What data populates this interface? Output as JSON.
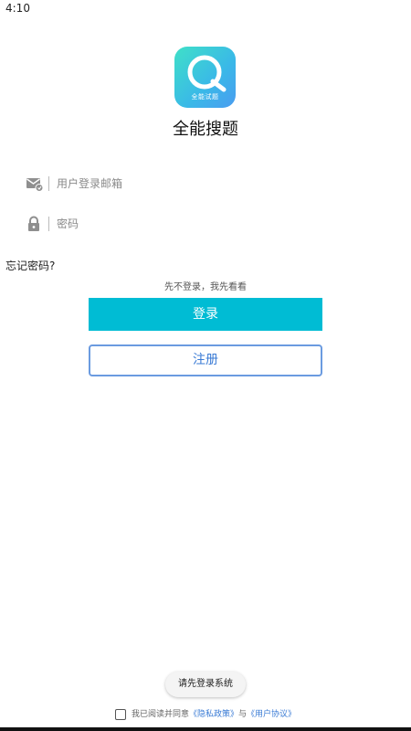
{
  "status_bar": {
    "time": "4:10"
  },
  "app": {
    "logo_text": "全能试题",
    "title": "全能搜题"
  },
  "login_form": {
    "email_placeholder": "用户登录邮箱",
    "password_placeholder": "密码",
    "forgot_password": "忘记密码?",
    "skip_login": "先不登录，我先看看",
    "login_button": "登录",
    "register_button": "注册"
  },
  "toast": {
    "text": "请先登录系统"
  },
  "agreement": {
    "prefix": "我已阅读并同意",
    "privacy_link": "《隐私政策》",
    "and": "与",
    "user_agreement_link": "《用户协议》"
  },
  "colors": {
    "primary": "#00bcd4",
    "link": "#3a7bd5",
    "register_border": "#6b9be0"
  },
  "icons": {
    "email": "mail-icon",
    "password": "lock-icon"
  }
}
